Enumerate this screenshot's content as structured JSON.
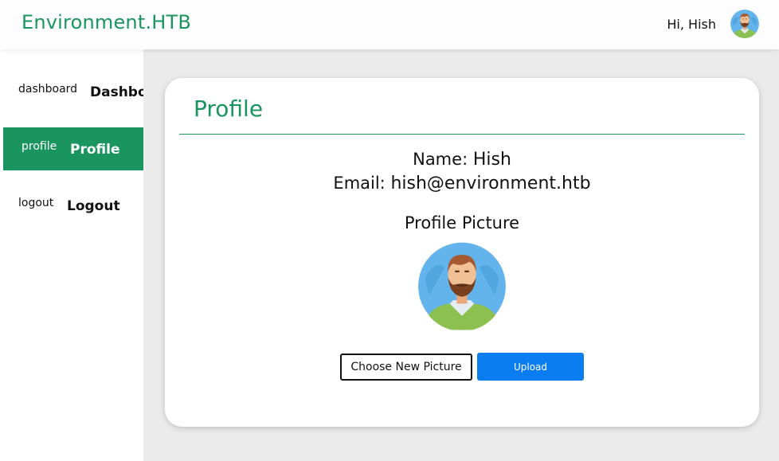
{
  "header": {
    "brand": "Environment.HTB",
    "greeting": "Hi, Hish",
    "avatar_icon": "user-avatar-icon"
  },
  "sidebar": {
    "items": [
      {
        "icon_text": "dashboard",
        "label": "Dashboard",
        "active": false
      },
      {
        "icon_text": "profile",
        "label": "Profile",
        "active": true
      },
      {
        "icon_text": "logout",
        "label": "Logout",
        "active": false
      }
    ]
  },
  "profile": {
    "title": "Profile",
    "name_label": "Name:",
    "name_value": "Hish",
    "email_label": "Email:",
    "email_value": "hish@environment.htb",
    "picture_heading": "Profile Picture",
    "choose_button": "Choose New Picture",
    "upload_button": "Upload"
  },
  "colors": {
    "accent": "#1a9560",
    "upload": "#0a7df0",
    "background": "#ebebeb"
  }
}
